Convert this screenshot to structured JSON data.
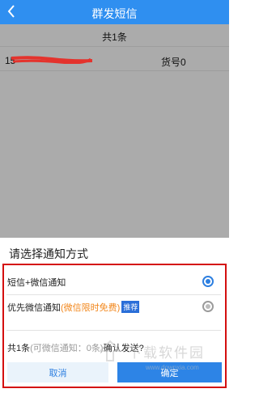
{
  "header": {
    "title": "群发短信",
    "back_icon": "chevron-left-icon"
  },
  "summary": {
    "count_label": "共1条"
  },
  "recipient": {
    "phone_partial": "15",
    "goods_label": "货号0"
  },
  "sheet": {
    "title": "请选择通知方式",
    "options": [
      {
        "label": "短信+微信通知",
        "selected": true
      },
      {
        "label": "优先微信通知",
        "note": "(微信限时免费)",
        "badge": "推荐",
        "selected": false
      }
    ],
    "confirm": {
      "count": "共1条",
      "detail": "(可微信通知：0条)",
      "question": "确认发送?"
    },
    "cancel_label": "取消",
    "ok_label": "确定"
  },
  "watermark": {
    "text": "下载软件园",
    "url": "www.downxia.com"
  },
  "colors": {
    "header": "#2f8ff0",
    "accent": "#2d7fe0",
    "highlight_border": "#d40f0f",
    "note_orange": "#f2871c"
  }
}
